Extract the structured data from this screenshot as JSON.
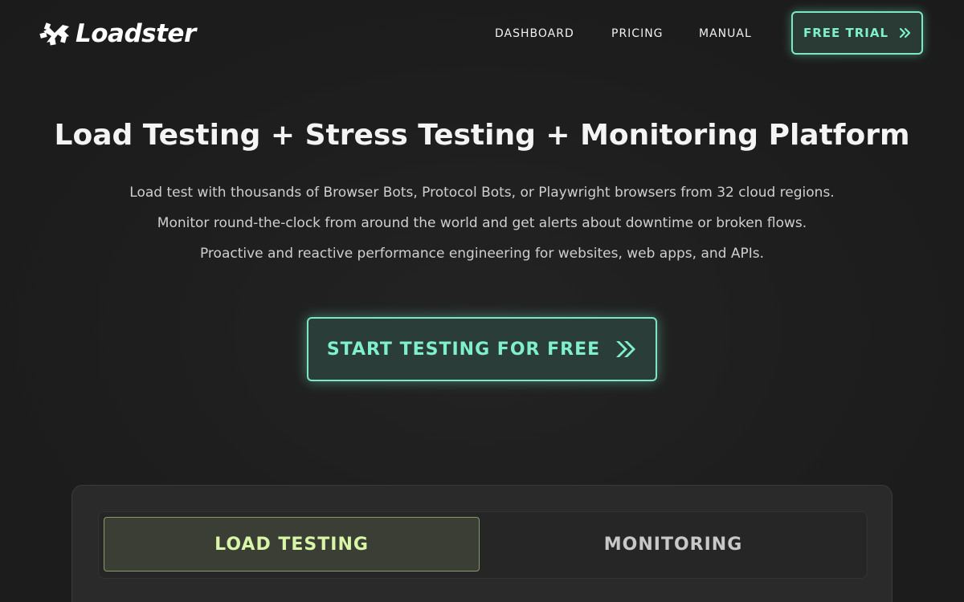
{
  "brand": {
    "name": "Loadster"
  },
  "nav": {
    "items": [
      {
        "label": "DASHBOARD"
      },
      {
        "label": "PRICING"
      },
      {
        "label": "MANUAL"
      }
    ],
    "trial_label": "FREE TRIAL"
  },
  "hero": {
    "title": "Load Testing + Stress Testing + Monitoring Platform",
    "subtitle_lines": [
      "Load test with thousands of Browser Bots, Protocol Bots, or Playwright browsers from 32 cloud regions.",
      "Monitor round-the-clock from around the world and get alerts about downtime or broken flows.",
      "Proactive and reactive performance engineering for websites, web apps, and APIs."
    ],
    "cta_label": "START TESTING FOR FREE"
  },
  "tabs": [
    {
      "label": "LOAD TESTING",
      "active": true
    },
    {
      "label": "MONITORING",
      "active": false
    }
  ],
  "colors": {
    "accent": "#7ff0c9",
    "background": "#1e1e1e",
    "active_tab_text": "#d9f5a8"
  },
  "icons": {
    "logo": "loadster-gear-logo-icon",
    "trial": "double-chevron-right-icon",
    "cta": "double-chevron-right-icon"
  }
}
